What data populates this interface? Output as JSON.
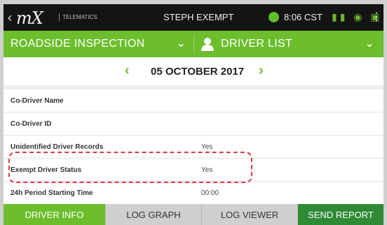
{
  "statusbar": {
    "logo": "mX",
    "logo_sub": "TELEMATICS",
    "title": "STEPH EXEMPT",
    "time": "8:06 CST"
  },
  "header": {
    "left_label": "ROADSIDE INSPECTION",
    "right_label": "DRIVER LIST"
  },
  "date": {
    "text": "05 OCTOBER 2017"
  },
  "rows": [
    {
      "label": "Co-Driver Name",
      "value": ""
    },
    {
      "label": "Co-Driver ID",
      "value": ""
    },
    {
      "label": "Unidentified Driver Records",
      "value": "Yes"
    },
    {
      "label": "Exempt Driver Status",
      "value": "Yes"
    },
    {
      "label": "24h Period Starting Time",
      "value": "00:00"
    }
  ],
  "tabs": [
    {
      "label": "DRIVER INFO",
      "active": true
    },
    {
      "label": "LOG GRAPH",
      "active": false
    },
    {
      "label": "LOG VIEWER",
      "active": false
    },
    {
      "label": "SEND REPORT",
      "active": false
    }
  ],
  "colors": {
    "green": "#6cbe2d",
    "dark_green": "#2f8a35",
    "highlight_red": "#e03a3a"
  }
}
